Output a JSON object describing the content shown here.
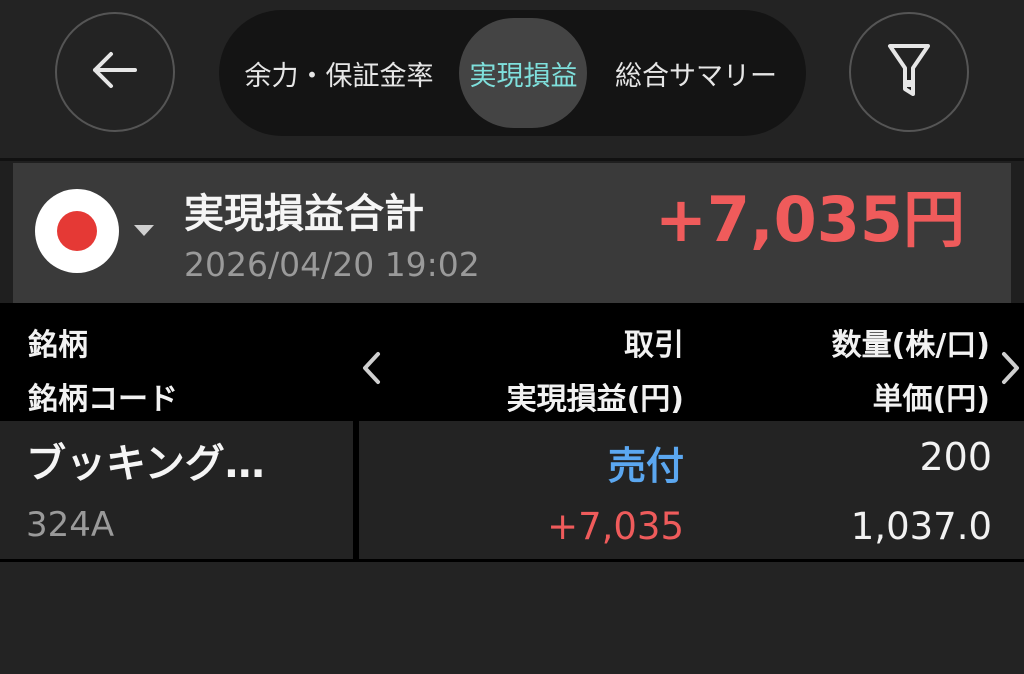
{
  "header": {
    "back_icon": "arrow-left-icon",
    "filter_icon": "filter-icon",
    "tabs": [
      {
        "label": "余力・保証金率",
        "active": false
      },
      {
        "label": "実現損益",
        "active": true
      },
      {
        "label": "総合サマリー",
        "active": false
      }
    ]
  },
  "summary": {
    "flag_icon": "japan-flag-icon",
    "title": "実現損益合計",
    "datetime": "2026/04/20 19:02",
    "total": "+7,035円"
  },
  "columns": {
    "left_top": "銘柄",
    "left_bottom": "銘柄コード",
    "mid_top": "取引",
    "mid_bottom": "実現損益(円)",
    "right_top": "数量(株/口)",
    "right_bottom": "単価(円)"
  },
  "rows": [
    {
      "name": "ブッキング…",
      "code": "324A",
      "trade": "売付",
      "pnl": "+7,035",
      "quantity": "200",
      "price": "1,037.0"
    }
  ],
  "colors": {
    "profit": "#ef5b5b",
    "sell": "#5ba7f0",
    "active_tab": "#7fe0dc"
  }
}
